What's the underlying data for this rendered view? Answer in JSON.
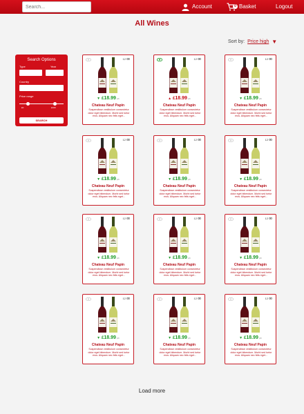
{
  "header": {
    "search_placeholder": "Search...",
    "account_label": "Account",
    "basket_label": "Basket",
    "basket_count": "0",
    "logout_label": "Logout"
  },
  "page_title": "All Wines",
  "sort": {
    "label": "Sort by:",
    "value": "Price high"
  },
  "filter": {
    "title": "Search Options",
    "type_label": "Type",
    "year_label": "Year",
    "country_label": "Country",
    "price_label": "Price range",
    "price_min": "£0",
    "price_max": "£100",
    "price_range_fraction": [
      0.2,
      0.8
    ],
    "search_button": "SEARCH"
  },
  "products": [
    {
      "name": "Chateau Neuf Papin",
      "price": "18.99",
      "trend": "down",
      "count": "12",
      "favourite": false,
      "description": "Suspendisse vestibulum consectetur dolor eget bibendum. Morbi sed tortor eros. Aliquam nec felis eget..."
    },
    {
      "name": "Chateau Neuf Papin",
      "price": "18.99",
      "trend": "up",
      "count": "12",
      "favourite": true,
      "description": "Suspendisse vestibulum consectetur dolor eget bibendum. Morbi sed tortor eros. Aliquam nec felis eget..."
    },
    {
      "name": "Chateau Neuf Papin",
      "price": "18.99",
      "trend": "down",
      "count": "12",
      "favourite": false,
      "description": "Suspendisse vestibulum consectetur dolor eget bibendum. Morbi sed tortor eros. Aliquam nec felis eget..."
    },
    {
      "name": "Chateau Neuf Papin",
      "price": "18.99",
      "trend": "down",
      "count": "12",
      "favourite": false,
      "description": "Suspendisse vestibulum consectetur dolor eget bibendum. Morbi sed tortor eros. Aliquam nec felis eget..."
    },
    {
      "name": "Chateau Neuf Papin",
      "price": "18.99",
      "trend": "down",
      "count": "12",
      "favourite": false,
      "description": "Suspendisse vestibulum consectetur dolor eget bibendum. Morbi sed tortor eros. Aliquam nec felis eget..."
    },
    {
      "name": "Chateau Neuf Papin",
      "price": "18.99",
      "trend": "down",
      "count": "12",
      "favourite": false,
      "description": "Suspendisse vestibulum consectetur dolor eget bibendum. Morbi sed tortor eros. Aliquam nec felis eget..."
    },
    {
      "name": "Chateau Neuf Papin",
      "price": "18.99",
      "trend": "down",
      "count": "12",
      "favourite": false,
      "description": "Suspendisse vestibulum consectetur dolor eget bibendum. Morbi sed tortor eros. Aliquam nec felis eget..."
    },
    {
      "name": "Chateau Neuf Papin",
      "price": "18.99",
      "trend": "down",
      "count": "12",
      "favourite": false,
      "description": "Suspendisse vestibulum consectetur dolor eget bibendum. Morbi sed tortor eros. Aliquam nec felis eget..."
    },
    {
      "name": "Chateau Neuf Papin",
      "price": "18.99",
      "trend": "down",
      "count": "12",
      "favourite": false,
      "description": "Suspendisse vestibulum consectetur dolor eget bibendum. Morbi sed tortor eros. Aliquam nec felis eget..."
    },
    {
      "name": "Chateau Neuf Papin",
      "price": "18.99",
      "trend": "down",
      "count": "12",
      "favourite": false,
      "description": "Suspendisse vestibulum consectetur dolor eget bibendum. Morbi sed tortor eros. Aliquam nec felis eget..."
    },
    {
      "name": "Chateau Neuf Papin",
      "price": "18.99",
      "trend": "down",
      "count": "12",
      "favourite": false,
      "description": "Suspendisse vestibulum consectetur dolor eget bibendum. Morbi sed tortor eros. Aliquam nec felis eget..."
    },
    {
      "name": "Chateau Neuf Papin",
      "price": "18.99",
      "trend": "down",
      "count": "12",
      "favourite": false,
      "description": "Suspendisse vestibulum consectetur dolor eget bibendum. Morbi sed tortor eros. Aliquam nec felis eget..."
    }
  ],
  "load_more": "Load more",
  "colors": {
    "brand_red": "#c40913",
    "price_green": "#1c9b27"
  }
}
